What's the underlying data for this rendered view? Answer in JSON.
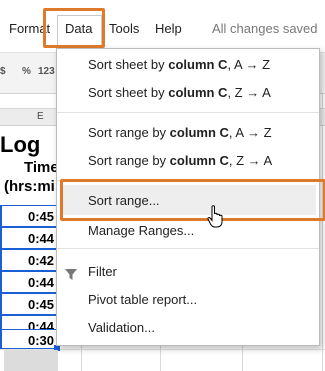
{
  "menubar": {
    "format": "Format",
    "data": "Data",
    "tools": "Tools",
    "help": "Help",
    "status": "All changes saved"
  },
  "toolbar": {
    "currency_symbol": "$",
    "percent_symbol": "%",
    "number_format": "123"
  },
  "sheet": {
    "column_label": "E",
    "title_fragment": "Log",
    "time_header_line1": "Time",
    "time_header_line2": "(hrs:mi",
    "time_values": [
      "0:45",
      "0:44",
      "0:42",
      "0:44",
      "0:45",
      "0:44",
      "0:30"
    ]
  },
  "dropdown": {
    "sort_sheet_az_prefix": "Sort sheet by ",
    "sort_sheet_az_bold": "column C",
    "sort_sheet_az_suffix": ", A → Z",
    "sort_sheet_za_prefix": "Sort sheet by ",
    "sort_sheet_za_bold": "column C",
    "sort_sheet_za_suffix": ", Z → A",
    "sort_range_az_prefix": "Sort range by ",
    "sort_range_az_bold": "column C",
    "sort_range_az_suffix": ", A → Z",
    "sort_range_za_prefix": "Sort range by ",
    "sort_range_za_bold": "column C",
    "sort_range_za_suffix": ", Z → A",
    "sort_range": "Sort range...",
    "manage_ranges": "Manage Ranges...",
    "filter": "Filter",
    "pivot_table": "Pivot table report...",
    "validation": "Validation..."
  },
  "colors": {
    "highlight": "#e07a2b",
    "selection": "#1a5fd6"
  },
  "icons": {
    "filter": "filter-icon",
    "cursor": "hand-cursor-icon"
  }
}
